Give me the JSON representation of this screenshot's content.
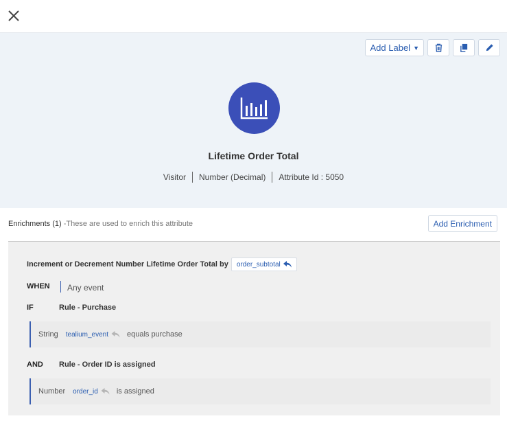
{
  "header": {
    "close_icon": "close-icon"
  },
  "toolbar": {
    "add_label": "Add Label",
    "icons": [
      "chevron-down-icon",
      "trash-icon",
      "copy-icon",
      "pencil-icon"
    ]
  },
  "attribute": {
    "icon": "bar-chart-icon",
    "accent_color": "#3b4fb8",
    "title": "Lifetime Order Total",
    "scope": "Visitor",
    "type": "Number (Decimal)",
    "id_text": "Attribute Id : 5050"
  },
  "enrichments": {
    "heading": "Enrichments (1)",
    "subheading": " -These are used to enrich this attribute",
    "add_button": "Add Enrichment",
    "items": [
      {
        "description": "Increment or Decrement Number Lifetime Order Total by",
        "variable": "order_subtotal",
        "when_label": "WHEN",
        "when_value": "Any event",
        "rules": [
          {
            "keyword": "IF",
            "name": "Rule - Purchase",
            "condition": {
              "type": "String",
              "variable": "tealium_event",
              "operator": "equals purchase"
            }
          },
          {
            "keyword": "AND",
            "name": "Rule - Order ID is assigned",
            "condition": {
              "type": "Number",
              "variable": "order_id",
              "operator": "is assigned"
            }
          }
        ]
      }
    ]
  }
}
